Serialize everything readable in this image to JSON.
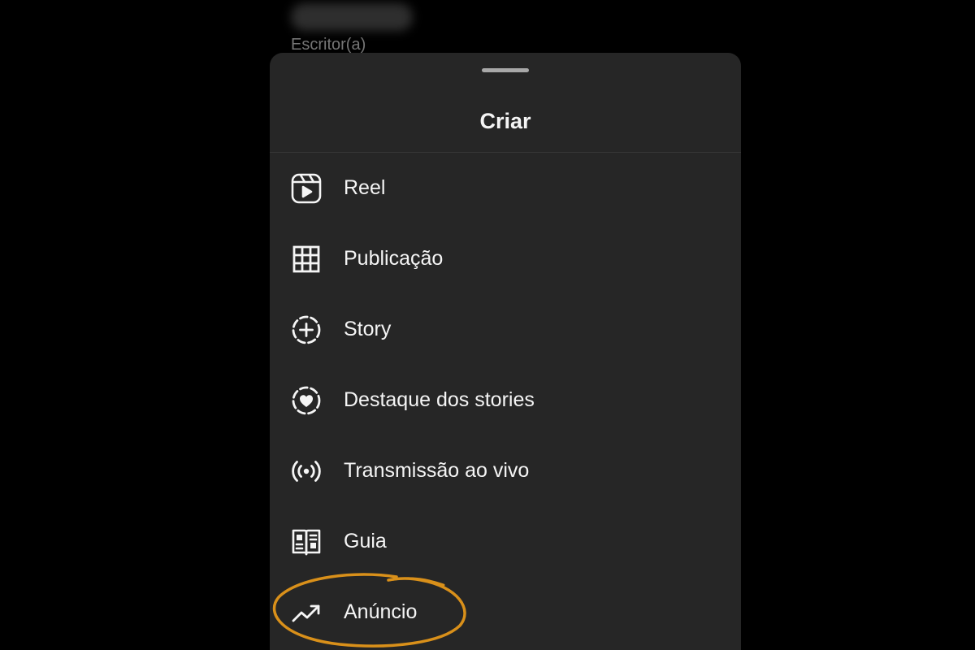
{
  "background": {
    "subtitle": "Escritor(a)"
  },
  "sheet": {
    "title": "Criar",
    "items": [
      {
        "label": "Reel",
        "icon": "reels-icon"
      },
      {
        "label": "Publicação",
        "icon": "grid-icon"
      },
      {
        "label": "Story",
        "icon": "story-add-icon"
      },
      {
        "label": "Destaque dos stories",
        "icon": "highlight-heart-icon"
      },
      {
        "label": "Transmissão ao vivo",
        "icon": "live-broadcast-icon"
      },
      {
        "label": "Guia",
        "icon": "guide-book-icon"
      },
      {
        "label": "Anúncio",
        "icon": "trending-up-icon"
      }
    ]
  },
  "colors": {
    "sheet_bg": "#262626",
    "text": "#f5f5f5",
    "highlight": "#d9901a"
  }
}
